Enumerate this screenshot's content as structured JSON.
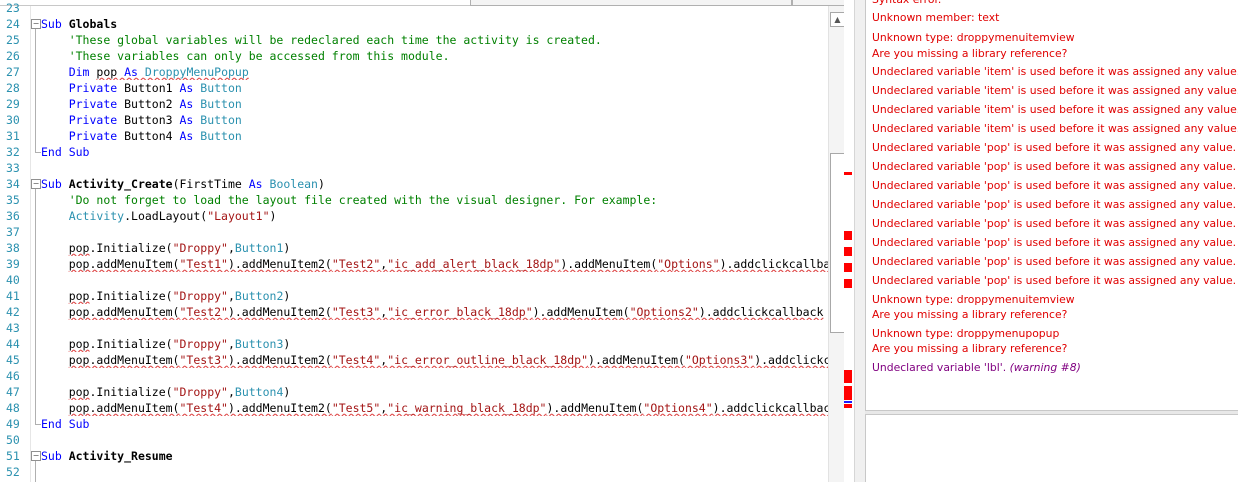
{
  "editor": {
    "lines": [
      {
        "n": "23",
        "tokens": []
      },
      {
        "n": "24",
        "fold": "start",
        "tokens": [
          {
            "t": "Sub ",
            "c": "kw"
          },
          {
            "t": "Globals",
            "c": "fn"
          }
        ]
      },
      {
        "n": "25",
        "tokens": [
          {
            "t": "    "
          },
          {
            "t": "'These global variables will be redeclared each time the activity is created.",
            "c": "cm"
          }
        ]
      },
      {
        "n": "26",
        "tokens": [
          {
            "t": "    "
          },
          {
            "t": "'These variables can only be accessed from this module.",
            "c": "cm"
          }
        ]
      },
      {
        "n": "27",
        "tokens": [
          {
            "t": "    "
          },
          {
            "t": "Dim ",
            "c": "kw"
          },
          {
            "t": "pop",
            "c": "pl",
            "e": 1
          },
          {
            "t": " ",
            "e": 1
          },
          {
            "t": "As ",
            "c": "kw",
            "e": 1
          },
          {
            "t": "DroppyMenuPopup",
            "c": "tp",
            "e": 1
          }
        ]
      },
      {
        "n": "28",
        "tokens": [
          {
            "t": "    "
          },
          {
            "t": "Private ",
            "c": "kw"
          },
          {
            "t": "Button1 ",
            "c": "pl"
          },
          {
            "t": "As ",
            "c": "kw"
          },
          {
            "t": "Button",
            "c": "tp"
          }
        ]
      },
      {
        "n": "29",
        "tokens": [
          {
            "t": "    "
          },
          {
            "t": "Private ",
            "c": "kw"
          },
          {
            "t": "Button2 ",
            "c": "pl"
          },
          {
            "t": "As ",
            "c": "kw"
          },
          {
            "t": "Button",
            "c": "tp"
          }
        ]
      },
      {
        "n": "30",
        "tokens": [
          {
            "t": "    "
          },
          {
            "t": "Private ",
            "c": "kw"
          },
          {
            "t": "Button3 ",
            "c": "pl"
          },
          {
            "t": "As ",
            "c": "kw"
          },
          {
            "t": "Button",
            "c": "tp"
          }
        ]
      },
      {
        "n": "31",
        "tokens": [
          {
            "t": "    "
          },
          {
            "t": "Private ",
            "c": "kw"
          },
          {
            "t": "Button4 ",
            "c": "pl"
          },
          {
            "t": "As ",
            "c": "kw"
          },
          {
            "t": "Button",
            "c": "tp"
          }
        ]
      },
      {
        "n": "32",
        "fold": "end",
        "tokens": [
          {
            "t": "End Sub",
            "c": "kw"
          }
        ]
      },
      {
        "n": "33",
        "tokens": []
      },
      {
        "n": "34",
        "fold": "start",
        "tokens": [
          {
            "t": "Sub ",
            "c": "kw"
          },
          {
            "t": "Activity_Create",
            "c": "fn"
          },
          {
            "t": "(FirstTime ",
            "c": "pl"
          },
          {
            "t": "As ",
            "c": "kw"
          },
          {
            "t": "Boolean",
            "c": "tp"
          },
          {
            "t": ")",
            "c": "pl"
          }
        ]
      },
      {
        "n": "35",
        "tokens": [
          {
            "t": "    "
          },
          {
            "t": "'Do not forget to load the layout file created with the visual designer. For example:",
            "c": "cm"
          }
        ]
      },
      {
        "n": "36",
        "tokens": [
          {
            "t": "    "
          },
          {
            "t": "Activity",
            "c": "tp"
          },
          {
            "t": ".LoadLayout(",
            "c": "pl"
          },
          {
            "t": "\"Layout1\"",
            "c": "st"
          },
          {
            "t": ")",
            "c": "pl"
          }
        ]
      },
      {
        "n": "37",
        "tokens": []
      },
      {
        "n": "38",
        "tokens": [
          {
            "t": "    "
          },
          {
            "t": "pop",
            "c": "pl",
            "e": 1
          },
          {
            "t": ".Initialize(",
            "c": "pl"
          },
          {
            "t": "\"Droppy\"",
            "c": "st"
          },
          {
            "t": ",",
            "c": "pl"
          },
          {
            "t": "Button1",
            "c": "tp"
          },
          {
            "t": ")",
            "c": "pl"
          }
        ]
      },
      {
        "n": "39",
        "tokens": [
          {
            "t": "    "
          },
          {
            "t": "pop.addMenuItem(",
            "c": "pl",
            "e": 1
          },
          {
            "t": "\"Test1\"",
            "c": "st",
            "e": 1
          },
          {
            "t": ").addMenuItem2(",
            "c": "pl",
            "e": 1
          },
          {
            "t": "\"Test2\"",
            "c": "st",
            "e": 1
          },
          {
            "t": ",",
            "c": "pl",
            "e": 1
          },
          {
            "t": "\"ic_add_alert_black_18dp\"",
            "c": "st",
            "e": 1
          },
          {
            "t": ").addMenuItem(",
            "c": "pl",
            "e": 1
          },
          {
            "t": "\"Options\"",
            "c": "st",
            "e": 1
          },
          {
            "t": ").addclickcallback",
            "c": "pl",
            "e": 1
          }
        ]
      },
      {
        "n": "40",
        "tokens": []
      },
      {
        "n": "41",
        "tokens": [
          {
            "t": "    "
          },
          {
            "t": "pop",
            "c": "pl",
            "e": 1
          },
          {
            "t": ".Initialize(",
            "c": "pl"
          },
          {
            "t": "\"Droppy\"",
            "c": "st"
          },
          {
            "t": ",",
            "c": "pl"
          },
          {
            "t": "Button2",
            "c": "tp"
          },
          {
            "t": ")",
            "c": "pl"
          }
        ]
      },
      {
        "n": "42",
        "tokens": [
          {
            "t": "    "
          },
          {
            "t": "pop.addMenuItem(",
            "c": "pl",
            "e": 1
          },
          {
            "t": "\"Test2\"",
            "c": "st",
            "e": 1
          },
          {
            "t": ").addMenuItem2(",
            "c": "pl",
            "e": 1
          },
          {
            "t": "\"Test3\"",
            "c": "st",
            "e": 1
          },
          {
            "t": ",",
            "c": "pl",
            "e": 1
          },
          {
            "t": "\"ic_error_black_18dp\"",
            "c": "st",
            "e": 1
          },
          {
            "t": ").addMenuItem(",
            "c": "pl",
            "e": 1
          },
          {
            "t": "\"Options2\"",
            "c": "st",
            "e": 1
          },
          {
            "t": ").addclickcallback",
            "c": "pl",
            "e": 1
          }
        ]
      },
      {
        "n": "43",
        "tokens": []
      },
      {
        "n": "44",
        "tokens": [
          {
            "t": "    "
          },
          {
            "t": "pop",
            "c": "pl",
            "e": 1
          },
          {
            "t": ".Initialize(",
            "c": "pl"
          },
          {
            "t": "\"Droppy\"",
            "c": "st"
          },
          {
            "t": ",",
            "c": "pl"
          },
          {
            "t": "Button3",
            "c": "tp"
          },
          {
            "t": ")",
            "c": "pl"
          }
        ]
      },
      {
        "n": "45",
        "tokens": [
          {
            "t": "    "
          },
          {
            "t": "pop.addMenuItem(",
            "c": "pl",
            "e": 1
          },
          {
            "t": "\"Test3\"",
            "c": "st",
            "e": 1
          },
          {
            "t": ").addMenuItem2(",
            "c": "pl",
            "e": 1
          },
          {
            "t": "\"Test4\"",
            "c": "st",
            "e": 1
          },
          {
            "t": ",",
            "c": "pl",
            "e": 1
          },
          {
            "t": "\"ic_error_outline_black_18dp\"",
            "c": "st",
            "e": 1
          },
          {
            "t": ").addMenuItem(",
            "c": "pl",
            "e": 1
          },
          {
            "t": "\"Options3\"",
            "c": "st",
            "e": 1
          },
          {
            "t": ").addclickcallback",
            "c": "pl",
            "e": 1
          }
        ]
      },
      {
        "n": "46",
        "tokens": []
      },
      {
        "n": "47",
        "tokens": [
          {
            "t": "    "
          },
          {
            "t": "pop",
            "c": "pl",
            "e": 1
          },
          {
            "t": ".Initialize(",
            "c": "pl"
          },
          {
            "t": "\"Droppy\"",
            "c": "st"
          },
          {
            "t": ",",
            "c": "pl"
          },
          {
            "t": "Button4",
            "c": "tp"
          },
          {
            "t": ")",
            "c": "pl"
          }
        ]
      },
      {
        "n": "48",
        "tokens": [
          {
            "t": "    "
          },
          {
            "t": "pop.addMenuItem(",
            "c": "pl",
            "e": 1
          },
          {
            "t": "\"Test4\"",
            "c": "st",
            "e": 1
          },
          {
            "t": ").addMenuItem2(",
            "c": "pl",
            "e": 1
          },
          {
            "t": "\"Test5\"",
            "c": "st",
            "e": 1
          },
          {
            "t": ",",
            "c": "pl",
            "e": 1
          },
          {
            "t": "\"ic_warning_black_18dp\"",
            "c": "st",
            "e": 1
          },
          {
            "t": ").addMenuItem(",
            "c": "pl",
            "e": 1
          },
          {
            "t": "\"Options4\"",
            "c": "st",
            "e": 1
          },
          {
            "t": ").addclickcallback",
            "c": "pl",
            "e": 1
          }
        ]
      },
      {
        "n": "49",
        "fold": "end",
        "tokens": [
          {
            "t": "End Sub",
            "c": "kw"
          }
        ]
      },
      {
        "n": "50",
        "tokens": []
      },
      {
        "n": "51",
        "fold": "start",
        "tokens": [
          {
            "t": "Sub ",
            "c": "kw"
          },
          {
            "t": "Activity_Resume",
            "c": "fn"
          }
        ]
      },
      {
        "n": "52",
        "tokens": []
      }
    ]
  },
  "error_markers": [
    {
      "line": 172,
      "h": 3,
      "color": "red"
    },
    {
      "line": 231,
      "h": 9,
      "color": "red"
    },
    {
      "line": 247,
      "h": 9,
      "color": "red"
    },
    {
      "line": 263,
      "h": 9,
      "color": "red"
    },
    {
      "line": 279,
      "h": 9,
      "color": "red"
    },
    {
      "line": 370,
      "h": 13,
      "color": "red"
    },
    {
      "line": 386,
      "h": 14,
      "color": "red"
    },
    {
      "line": 401,
      "h": 2,
      "color": "blue"
    },
    {
      "line": 404,
      "h": 4,
      "color": "red"
    }
  ],
  "errors": {
    "items": [
      {
        "text": "Syntax error.",
        "color": "red"
      },
      {
        "text": "Unknown member: text",
        "color": "red"
      },
      {
        "text": "Unknown type: droppymenuitemview",
        "color": "red"
      },
      {
        "text": "Are you missing a library reference?",
        "color": "red"
      },
      {
        "text": "Undeclared variable 'item' is used before it was assigned any value.",
        "color": "red"
      },
      {
        "text": "Undeclared variable 'item' is used before it was assigned any value.",
        "color": "red"
      },
      {
        "text": "Undeclared variable 'item' is used before it was assigned any value.",
        "color": "red"
      },
      {
        "text": "Undeclared variable 'item' is used before it was assigned any value.",
        "color": "red"
      },
      {
        "text": "Undeclared variable 'pop' is used before it was assigned any value.",
        "color": "red"
      },
      {
        "text": "Undeclared variable 'pop' is used before it was assigned any value.",
        "color": "red"
      },
      {
        "text": "Undeclared variable 'pop' is used before it was assigned any value.",
        "color": "red"
      },
      {
        "text": "Undeclared variable 'pop' is used before it was assigned any value.",
        "color": "red"
      },
      {
        "text": "Undeclared variable 'pop' is used before it was assigned any value.",
        "color": "red"
      },
      {
        "text": "Undeclared variable 'pop' is used before it was assigned any value.",
        "color": "red"
      },
      {
        "text": "Undeclared variable 'pop' is used before it was assigned any value.",
        "color": "red"
      },
      {
        "text": "Undeclared variable 'pop' is used before it was assigned any value.",
        "color": "red"
      },
      {
        "text": "Unknown type: droppymenuitemview",
        "color": "red"
      },
      {
        "text": "Are you missing a library reference?",
        "color": "red"
      },
      {
        "text": "Unknown type: droppymenupopup",
        "color": "red"
      },
      {
        "text": "Are you missing a library reference?",
        "color": "red"
      },
      {
        "text": "Undeclared variable 'lbl'.",
        "warning": "(warning #8)",
        "color": "purple"
      }
    ]
  },
  "colors": {
    "error": "#e00000",
    "warning": "#800080",
    "marker_red": "#ff0000",
    "marker_blue": "#1a1aff"
  }
}
